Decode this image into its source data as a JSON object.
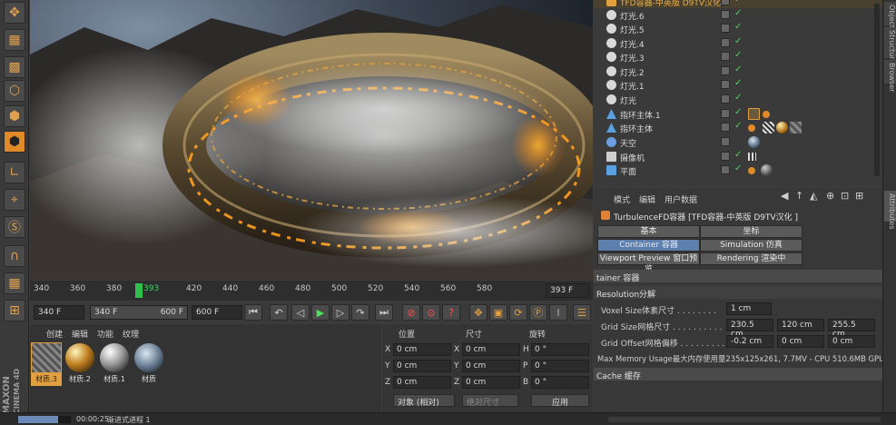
{
  "app": {
    "brand": "MAXON",
    "product": "CINEMA 4D"
  },
  "left_toolbar": {
    "tools": [
      "move-icon",
      "checker-icon",
      "texture-icon",
      "cube-add-icon",
      "cube-icon",
      "cube-active-icon",
      "angle-icon",
      "mouse-icon",
      "snap-icon",
      "magnet-icon",
      "grid-lock-icon",
      "lock-icon"
    ]
  },
  "timeline": {
    "ticks": [
      "340",
      "360",
      "380",
      "393",
      "420",
      "440",
      "460",
      "480",
      "500",
      "520",
      "540",
      "560",
      "580"
    ],
    "current_frame": "393",
    "current_frame_field": "393 F"
  },
  "transport": {
    "start": "340 F",
    "range_start": "340 F",
    "range_end": "600 F",
    "end": "600 F"
  },
  "material_manager": {
    "menu": [
      "创建",
      "编辑",
      "功能",
      "纹理"
    ],
    "materials": [
      {
        "label": "材质.3",
        "selected": true,
        "style": "stripes"
      },
      {
        "label": "材质.2",
        "selected": false,
        "style": "gold"
      },
      {
        "label": "材质.1",
        "selected": false,
        "style": "chrome"
      },
      {
        "label": "材质",
        "selected": false,
        "style": "sky"
      }
    ]
  },
  "coordinates": {
    "headers": {
      "position": "位置",
      "size": "尺寸",
      "rotation": "旋转"
    },
    "rows": [
      {
        "axis": "X",
        "pos": "0 cm",
        "size_axis": "X",
        "size": "0 cm",
        "rot_axis": "H",
        "rot": "0 °"
      },
      {
        "axis": "Y",
        "pos": "0 cm",
        "size_axis": "Y",
        "size": "0 cm",
        "rot_axis": "P",
        "rot": "0 °"
      },
      {
        "axis": "Z",
        "pos": "0 cm",
        "size_axis": "Z",
        "size": "0 cm",
        "rot_axis": "B",
        "rot": "0 °"
      }
    ],
    "mode_dropdown": "对象 (相对)",
    "size_dropdown": "绝对尺寸",
    "apply_label": "应用"
  },
  "statusbar": {
    "time": "00:00:25",
    "text": "渐进式进程 1",
    "progress": 0.75
  },
  "object_manager": {
    "objects": [
      {
        "name": "TFD容器-中英版 D9TV汉化",
        "icon": "turbulence-icon",
        "color": "#e0a040",
        "highlight": true
      },
      {
        "name": "灯光.6",
        "icon": "light-icon",
        "color": "#d8d8d8"
      },
      {
        "name": "灯光.5",
        "icon": "light-icon",
        "color": "#d8d8d8"
      },
      {
        "name": "灯光.4",
        "icon": "light-icon",
        "color": "#d8d8d8"
      },
      {
        "name": "灯光.3",
        "icon": "light-icon",
        "color": "#d8d8d8"
      },
      {
        "name": "灯光.2",
        "icon": "light-icon",
        "color": "#d8d8d8"
      },
      {
        "name": "灯光.1",
        "icon": "light-icon",
        "color": "#d8d8d8"
      },
      {
        "name": "灯光",
        "icon": "light-icon",
        "color": "#d8d8d8"
      },
      {
        "name": "指环主体.1",
        "icon": "pyramid-icon",
        "color": "#5aa0e0"
      },
      {
        "name": "指环主体",
        "icon": "pyramid-icon",
        "color": "#5aa0e0"
      },
      {
        "name": "天空",
        "icon": "sky-icon",
        "color": "#6a9ee0"
      },
      {
        "name": "摄像机",
        "icon": "camera-icon",
        "color": "#cfcfcf"
      },
      {
        "name": "平面",
        "icon": "plane-icon",
        "color": "#5aa0e0"
      }
    ]
  },
  "attribute_manager": {
    "menu": [
      "模式",
      "编辑",
      "用户数据"
    ],
    "object_title": "TurbulenceFD容器 [TFD容器-中英版 D9TV汉化 ]",
    "tabs": [
      {
        "label": "基本",
        "active": false
      },
      {
        "label": "坐标",
        "active": false
      },
      {
        "label": "Container 容器",
        "active": true
      },
      {
        "label": "Simulation 仿真",
        "active": false
      },
      {
        "label": "Viewport Preview 窗口预览",
        "active": false
      },
      {
        "label": "Rendering 渲染中",
        "active": false
      }
    ],
    "section_container": "tainer 容器",
    "section_resolution": "Resolution分解",
    "voxel_label": "Voxel Size体素尺寸 . . . . . . . .",
    "voxel_value": "1 cm",
    "grid_size_label": "Grid Size网格尺寸 . . . . . . . . . .",
    "grid_size": [
      "230.5 cm",
      "120 cm",
      "255.5 cm"
    ],
    "grid_offset_label": "Grid Offset网格偏移 . . . . . . . . .",
    "grid_offset": [
      "-0.2 cm",
      "0 cm",
      "0 cm"
    ],
    "memory_text": "Max Memory Usage最大内存使用量235x125x261, 7.7MV - CPU 510.6MB GPU",
    "section_cache": "Cache 缓存"
  },
  "right_tabs": [
    "Objects",
    "Structure",
    "Browser",
    "Attributes"
  ]
}
